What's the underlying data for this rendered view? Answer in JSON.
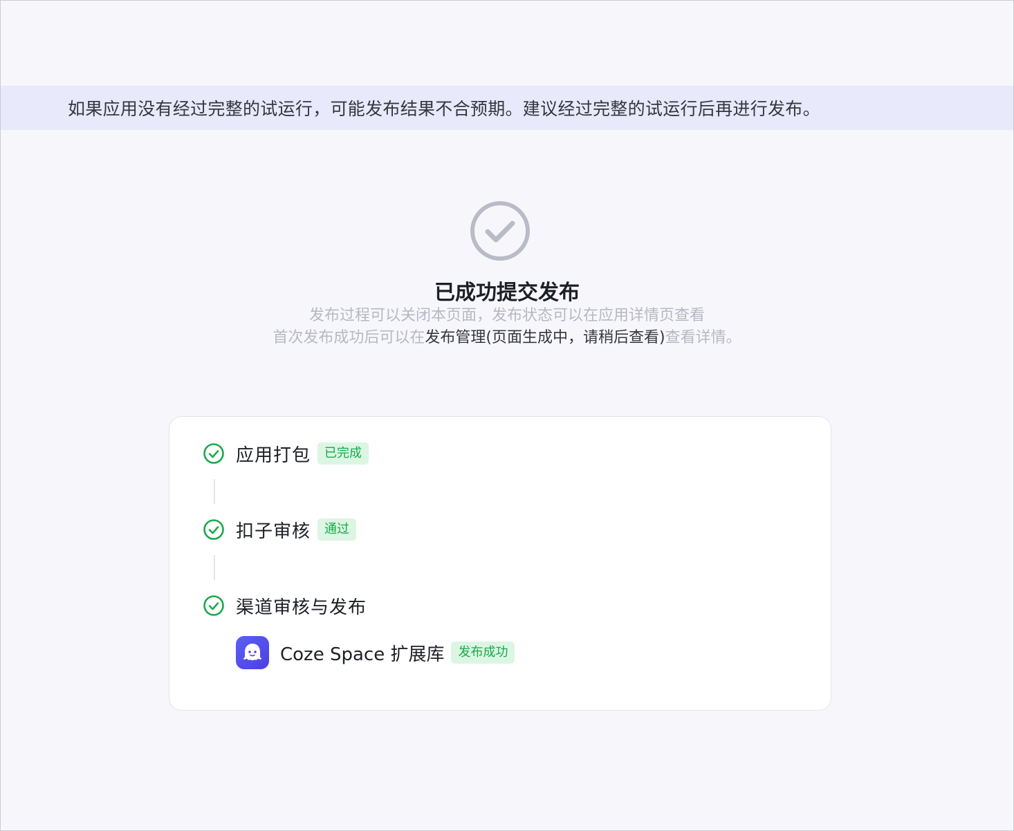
{
  "notice": {
    "text": "如果应用没有经过完整的试运行，可能发布结果不合预期。建议经过完整的试运行后再进行发布。"
  },
  "result": {
    "title": "已成功提交发布",
    "line1": "发布过程可以关闭本页面，发布状态可以在应用详情页查看",
    "line2_prefix": "首次发布成功后可以在",
    "line2_link": "发布管理(页面生成中，请稍后查看)",
    "line2_suffix": "查看详情。"
  },
  "steps": [
    {
      "label": "应用打包",
      "tag": "已完成",
      "icon": "check-circle-icon"
    },
    {
      "label": "扣子审核",
      "tag": "通过",
      "icon": "check-circle-icon"
    },
    {
      "label": "渠道审核与发布",
      "tag": "",
      "icon": "check-circle-icon"
    }
  ],
  "channel": {
    "name": "Coze Space 扩展库",
    "status": "发布成功",
    "icon": "coze-space-logo-icon"
  },
  "colors": {
    "success": "#19a94b",
    "success_bg": "#dcf6e3",
    "notice_bg": "#e8e9fb",
    "brand": "#4d4ff0"
  }
}
